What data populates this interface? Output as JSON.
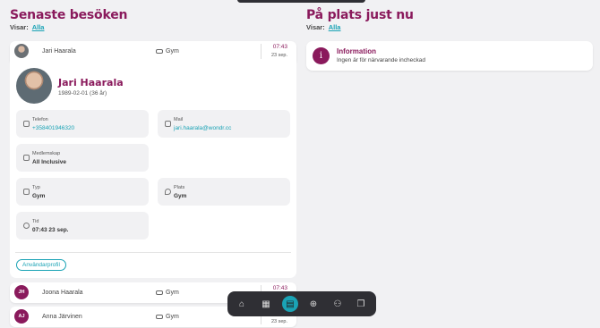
{
  "left": {
    "title": "Senaste besöken",
    "visar_label": "Visar:",
    "visar_value": "Alla",
    "expanded_row": {
      "name": "Jari Haarala",
      "place": "Gym",
      "time": "07:43",
      "date": "23 sep."
    },
    "profile": {
      "name": "Jari Haarala",
      "dob": "1989-02-01 (36 år)",
      "phone_label": "Telefon",
      "phone": "+358401946320",
      "mail_label": "Mail",
      "mail": "jari.haarala@wondr.cc",
      "membership_label": "Medlemskap",
      "membership": "All Inclusive",
      "type_label": "Typ",
      "type": "Gym",
      "place_label": "Plats",
      "place": "Gym",
      "time_label": "Tid",
      "time": "07:43 23 sep.",
      "profile_button": "Användarprofil"
    },
    "rows": [
      {
        "initials": "JH",
        "name": "Joona Haarala",
        "place": "Gym",
        "time": "07:43",
        "date": ""
      },
      {
        "initials": "AJ",
        "name": "Anna Järvinen",
        "place": "Gym",
        "time": "",
        "date": "23 sep."
      }
    ]
  },
  "right": {
    "title": "På plats just nu",
    "visar_label": "Visar:",
    "visar_value": "Alla",
    "info_title": "Information",
    "info_text": "Ingen är för närvarande incheckad"
  },
  "dock": {
    "icons": [
      "home-icon",
      "calendar-icon",
      "clipboard-icon",
      "add-user-icon",
      "group-icon",
      "documents-icon"
    ],
    "active": "clipboard-icon"
  },
  "colors": {
    "brand": "#8a1a5c",
    "accent": "#1aa3b5"
  }
}
